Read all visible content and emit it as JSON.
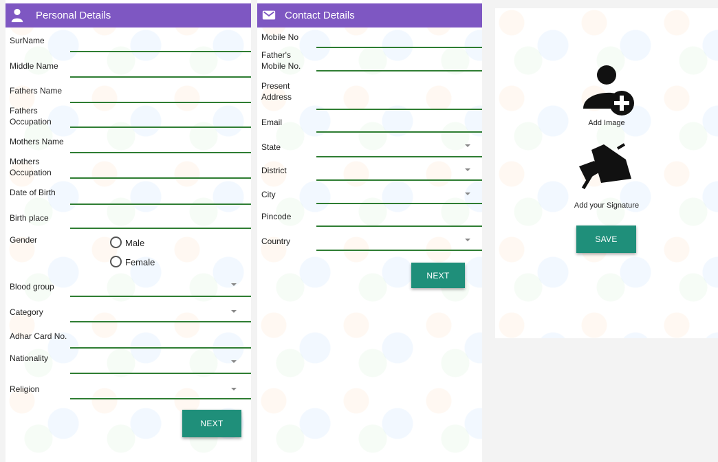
{
  "personal": {
    "header_title": "Personal Details",
    "fields": [
      {
        "label": "SurName"
      },
      {
        "label": "Middle Name"
      },
      {
        "label": "Fathers Name"
      },
      {
        "label": "Fathers\nOccupation"
      },
      {
        "label": "Mothers Name"
      },
      {
        "label": "Mothers\nOccupation"
      },
      {
        "label": "Date of Birth"
      },
      {
        "label": "Birth place"
      }
    ],
    "gender_label": "Gender",
    "gender_options": [
      "Male",
      "Female"
    ],
    "fields2": [
      {
        "label": "Blood group",
        "dropdown": true
      },
      {
        "label": "Category",
        "dropdown": true
      },
      {
        "label": "Adhar Card No.",
        "dropdown": false
      },
      {
        "label": "Nationality",
        "dropdown": true
      },
      {
        "label": "Religion",
        "dropdown": true
      }
    ],
    "next_label": "NEXT"
  },
  "contact": {
    "header_title": "Contact Details",
    "fields": [
      {
        "label": "Mobile No",
        "dropdown": false
      },
      {
        "label": "Father's\nMobile No.",
        "dropdown": false
      },
      {
        "label": "Present\nAddress",
        "dropdown": false
      },
      {
        "label": "Email",
        "dropdown": false
      },
      {
        "label": "State",
        "dropdown": true
      },
      {
        "label": "District",
        "dropdown": true
      },
      {
        "label": "City",
        "dropdown": true
      },
      {
        "label": "Pincode",
        "dropdown": false
      },
      {
        "label": "Country",
        "dropdown": true
      }
    ],
    "next_label": "NEXT"
  },
  "media": {
    "add_image_label": "Add Image",
    "add_signature_label": "Add your Signature",
    "save_label": "SAVE"
  },
  "colors": {
    "header": "#7e57c2",
    "underline": "#2e7d32",
    "button": "#1f8f7a"
  },
  "icons": [
    "person-icon",
    "contact-card-icon",
    "add-person-icon",
    "signature-pen-icon",
    "chevron-down-icon",
    "radio-icon"
  ]
}
